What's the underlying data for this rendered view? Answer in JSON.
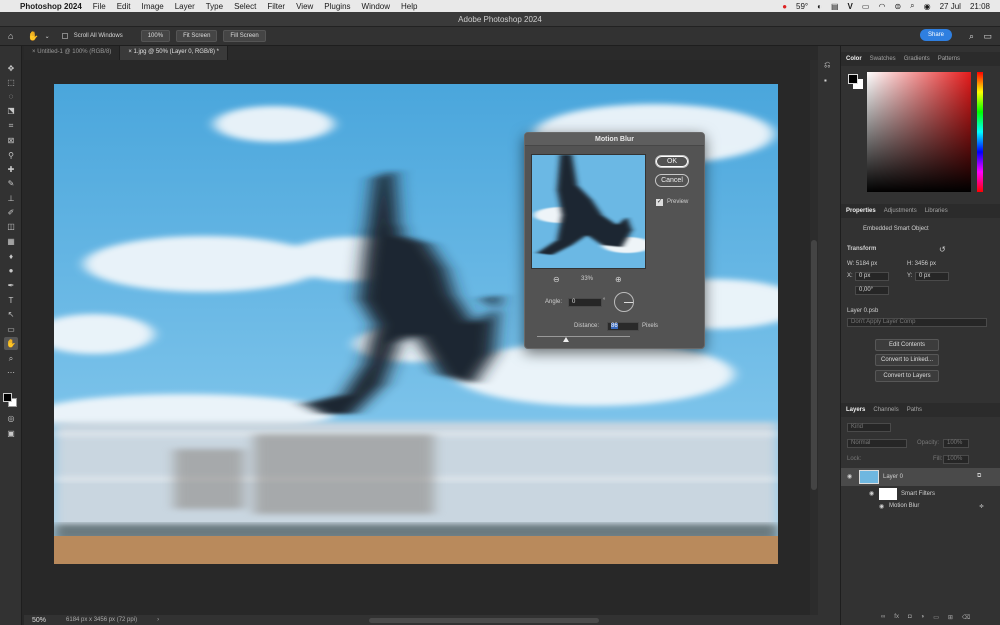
{
  "menubar": {
    "app": "Photoshop 2024",
    "items": [
      "File",
      "Edit",
      "Image",
      "Layer",
      "Type",
      "Select",
      "Filter",
      "View",
      "Plugins",
      "Window",
      "Help"
    ],
    "temp": "59°",
    "date": "27 Jul",
    "time": "21:08"
  },
  "window": {
    "title": "Adobe Photoshop 2024"
  },
  "options": {
    "scroll_all": "Scroll All Windows",
    "zoom100": "100%",
    "fit": "Fit Screen",
    "fill": "Fill Screen",
    "share": "Share"
  },
  "tabs": [
    {
      "label": "Untitled-1 @ 100% (RGB/8)"
    },
    {
      "label": "1.jpg @ 50% (Layer 0, RGB/8) *"
    }
  ],
  "status": {
    "zoom": "50%",
    "size": "6184 px x 3456 px (72 ppi)"
  },
  "panels": {
    "color_tabs": [
      "Color",
      "Swatches",
      "Gradients",
      "Patterns"
    ],
    "props_tabs": [
      "Properties",
      "Adjustments",
      "Libraries"
    ],
    "embedded": "Embedded Smart Object",
    "transform": "Transform",
    "w": "W: 5184 px",
    "h": "H: 3456 px",
    "x_lbl": "X:",
    "x_val": "0 px",
    "y_lbl": "Y:",
    "y_val": "0 px",
    "angle": "0,00°",
    "psb": "Layer 0.psb",
    "comp": "Don't Apply Layer Comp",
    "btn_edit": "Edit Contents",
    "btn_linked": "Convert to Linked...",
    "btn_layers": "Convert to Layers",
    "layers_tabs": [
      "Layers",
      "Channels",
      "Paths"
    ],
    "kind": "Kind",
    "blend": "Normal",
    "opacity": "Opacity:",
    "opacity_val": "100%",
    "lock": "Lock:",
    "fill": "Fill:",
    "fill_val": "100%",
    "layer0": "Layer 0",
    "smart_filters": "Smart Filters",
    "motion_blur": "Motion Blur"
  },
  "dialog": {
    "title": "Motion Blur",
    "ok": "OK",
    "cancel": "Cancel",
    "preview": "Preview",
    "zoom": "33%",
    "angle_lbl": "Angle:",
    "angle_val": "0",
    "deg": "°",
    "dist_lbl": "Distance:",
    "dist_val": "86",
    "unit": "Pixels"
  },
  "colors": {
    "accent": "#2f7fe0",
    "sky": "#5fb6e6"
  }
}
